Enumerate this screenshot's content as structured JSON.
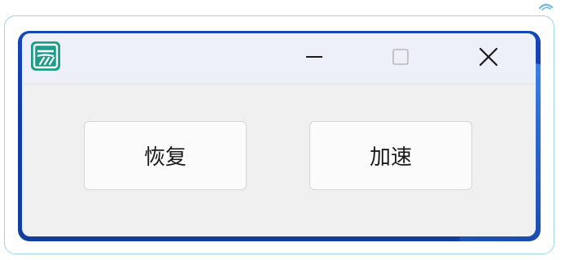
{
  "window": {
    "app_icon": "app-logo-icon",
    "controls": {
      "minimize_icon": "minimize-icon",
      "maximize_icon": "maximize-icon",
      "close_icon": "close-icon"
    }
  },
  "buttons": {
    "restore_label": "恢复",
    "accelerate_label": "加速"
  },
  "colors": {
    "app_icon_green": "#1e9e8a",
    "desktop_blue": "#1746b8",
    "window_bg": "#f0f0f0",
    "titlebar_bg": "#eef0f9",
    "frame_border": "#9fd3e6"
  }
}
